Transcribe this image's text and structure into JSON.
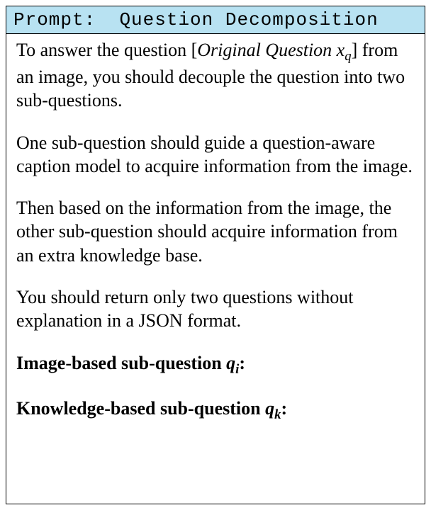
{
  "header": {
    "label_prefix": "Prompt:",
    "label_title": "Question Decomposition"
  },
  "content": {
    "p1_a": "To answer the question [",
    "p1_b": "Original Question x",
    "p1_b_sub": "q",
    "p1_c": "] from an image, you should decouple the question into two sub-questions.",
    "p2": "One sub-question should guide a question-aware caption model to acquire information from the image.",
    "p3": "Then based on the information from the image, the other sub-question should acquire information from an extra knowledge base.",
    "p4": "You should return only two questions without explanation in a JSON format.",
    "q_image_label_a": "Image-based sub-question ",
    "q_image_var": "q",
    "q_image_sub": "i",
    "q_image_colon": ":",
    "q_knowledge_label_a": "Knowledge-based sub-question ",
    "q_knowledge_var": "q",
    "q_knowledge_sub": "k",
    "q_knowledge_colon": ":"
  }
}
